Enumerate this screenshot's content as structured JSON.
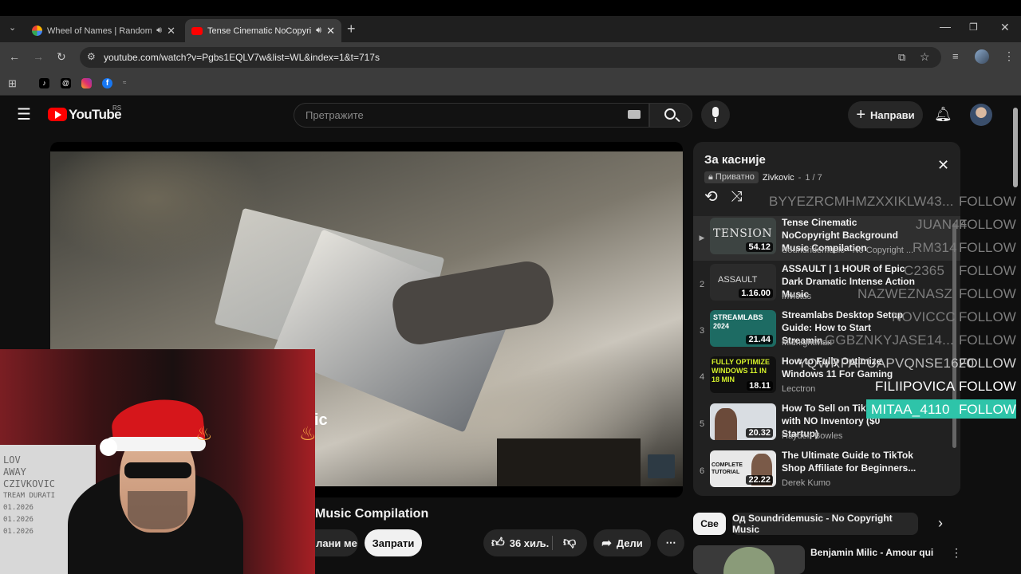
{
  "browser": {
    "tabs": [
      {
        "title": "Wheel of Names | Random",
        "favicon_color": "#ffb300"
      },
      {
        "title": "Tense Cinematic NoCopyrig",
        "favicon_color": "#ff0000"
      }
    ],
    "url": "youtube.com/watch?v=Pgbs1EQLV7w&list=WL&index=1&t=717s",
    "bookmarks": [
      "tiktok-icon",
      "threads-icon",
      "instagram-icon",
      "facebook-icon",
      "nv-icon"
    ]
  },
  "youtube": {
    "logo_text": "YouTube",
    "region": "RS",
    "search_placeholder": "Претражите",
    "create_label": "Направи"
  },
  "video": {
    "title_visible": "Music Compilation",
    "overlay_text": "ic",
    "like_count": "36 хиљ.",
    "share_label": "Дели",
    "subscribe_label": "Запрати",
    "member_label": "лани ме"
  },
  "playlist": {
    "title": "За касније",
    "privacy": "Приватно",
    "owner": "Zivkovic",
    "position": "1 / 7",
    "items": [
      {
        "index": "▶",
        "title": "Tense Cinematic NoCopyright Background Music Compilation",
        "channel": "Soundridemusic - No Copyright ...",
        "duration": "54.12",
        "thumb_text": "TENSION",
        "thumb_bg": "#3d4442"
      },
      {
        "index": "2",
        "title": "ASSAULT | 1 HOUR of Epic Dark Dramatic Intense Action Music",
        "channel": "Invictus",
        "duration": "1.16.00",
        "thumb_text": "ASSAULT",
        "thumb_bg": "#2b2b2b"
      },
      {
        "index": "3",
        "title": "Streamlabs Desktop Setup Guide: How to Start Streamin...",
        "channel": "MidnightMan",
        "duration": "21.44",
        "thumb_text": "STREAMLABS 2024",
        "thumb_bg": "#1d6b63"
      },
      {
        "index": "4",
        "title": "How to Fully Optimize Windows 11 For Gaming",
        "channel": "Lecctron",
        "duration": "18.11",
        "thumb_text": "FULLY OPTIMIZE WINDOWS 11 IN 18 MIN",
        "thumb_bg": "#101010"
      },
      {
        "index": "5",
        "title": "How To Sell on TikTok Shop with NO Inventory ($0 Startup)",
        "channel": "Hayden Bowles",
        "duration": "20.32",
        "thumb_text": "",
        "thumb_bg": "#d9dde2"
      },
      {
        "index": "6",
        "title": "The Ultimate Guide to TikTok Shop Affiliate for Beginners...",
        "channel": "Derek Kumo",
        "duration": "22.22",
        "thumb_text": "COMPLETE TUTORIAL",
        "thumb_bg": "#e8e8e8"
      }
    ]
  },
  "chips": [
    "Све",
    "Од Soundridemusic - No Copyright Music"
  ],
  "recommendation": {
    "title": "Benjamin Milic - Amour qui"
  },
  "chat": [
    {
      "name": "BYYEZRCMHMZXXIKLW43...",
      "follow": "FOLLOW",
      "style": "dim"
    },
    {
      "name": "JUAN44",
      "follow": "FOLLOW",
      "style": "dim"
    },
    {
      "name": "RM314",
      "follow": "FOLLOW",
      "style": "dim"
    },
    {
      "name": "C2365",
      "follow": "FOLLOW",
      "style": "dim"
    },
    {
      "name": "NAZWEZNASZ",
      "follow": "FOLLOW",
      "style": "dim"
    },
    {
      "name": "NOVICCC",
      "follow": "FOLLOW",
      "style": "dim"
    },
    {
      "name": "GGBZNKYJASE14...",
      "follow": "FOLLOW",
      "style": "dim"
    },
    {
      "name": "YQWRFAPUAPVQNSE1620",
      "follow": "FOLLOW",
      "style": "normal"
    },
    {
      "name": "FILIIPOVICA",
      "follow": "FOLLOW",
      "style": "bright"
    },
    {
      "name": "MITAA_4110",
      "follow": "FOLLOW",
      "style": "highlight"
    }
  ],
  "whiteboard_lines": [
    "LOV",
    "AWAY",
    "CZIVKOVIC",
    "TREAM DURATI",
    "01.2026",
    "01.2026",
    "01.2026"
  ],
  "colors": {
    "accent_red": "#ff0000",
    "chat_highlight": "#2ec4a9"
  }
}
